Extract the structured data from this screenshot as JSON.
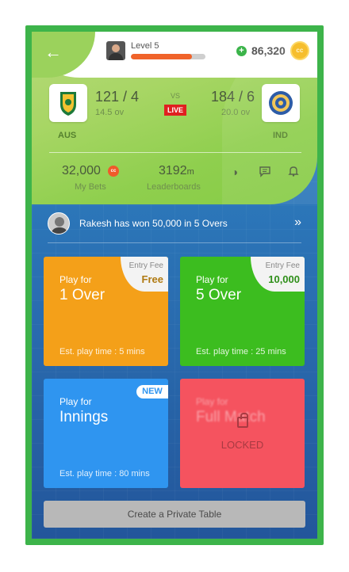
{
  "header": {
    "level_label": "Level 5",
    "xp_fraction": 0.82,
    "coin_balance": "86,320",
    "coin_icon_text": "cc"
  },
  "match": {
    "team1": {
      "name": "AUS",
      "score": "121 / 4",
      "overs": "14.5 ov"
    },
    "vs": "VS",
    "status": "LIVE",
    "team2": {
      "name": "IND",
      "score": "184 / 6",
      "overs": "20.0 ov"
    }
  },
  "stats": {
    "bets_value": "32,000",
    "bets_cc": "cc",
    "bets_label": "My Bets",
    "leaderboard_value": "3192",
    "leaderboard_unit": "m",
    "leaderboard_label": "Leaderboards"
  },
  "winner_banner": {
    "text": "Rakesh has won 50,000 in 5 Overs"
  },
  "cards": {
    "one_over": {
      "play_for": "Play for",
      "mode": "1 Over",
      "fee_label": "Entry Fee",
      "fee_value": "Free",
      "est": "Est. play time : 5 mins"
    },
    "five_over": {
      "play_for": "Play for",
      "mode": "5 Over",
      "fee_label": "Entry Fee",
      "fee_value": "10,000",
      "est": "Est. play time : 25 mins"
    },
    "innings": {
      "play_for": "Play for",
      "mode": "Innings",
      "badge": "NEW",
      "est": "Est. play time : 80 mins"
    },
    "full_match": {
      "play_for": "Play for",
      "mode": "Full Match",
      "locked": "LOCKED"
    }
  },
  "private_table_label": "Create a Private Table",
  "colors": {
    "one_over": "#f4a019",
    "five_over": "#3cbd1f",
    "innings": "#2f95f0",
    "full_match": "#f5535f",
    "live": "#e02020"
  },
  "icons": [
    "back-arrow-icon",
    "plus-icon",
    "coin-icon",
    "theme-icon",
    "chat-icon",
    "bell-icon",
    "chevron-double-right-icon",
    "lock-icon"
  ]
}
